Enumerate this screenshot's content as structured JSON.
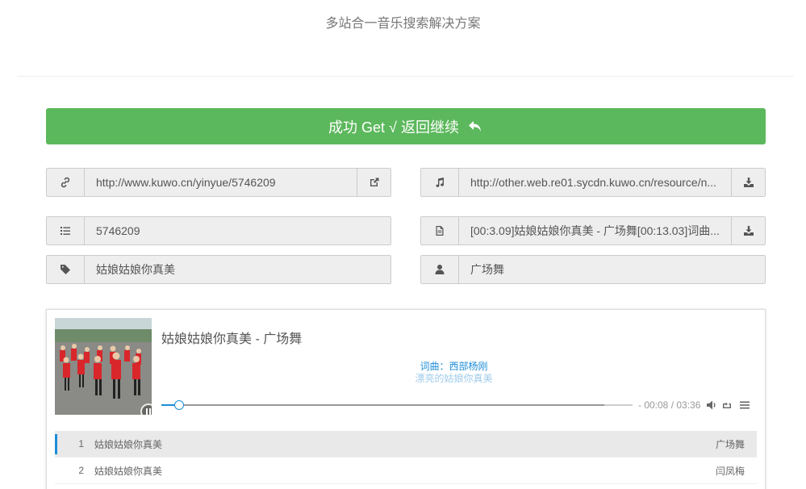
{
  "header": {
    "subtitle": "多站合一音乐搜索解决方案"
  },
  "success_bar": {
    "label": "成功 Get √ 返回继续"
  },
  "fields": {
    "link": {
      "icon": "link-icon",
      "value": "http://www.kuwo.cn/yinyue/5746209"
    },
    "music_url": {
      "icon": "music-icon",
      "value": "http://other.web.re01.sycdn.kuwo.cn/resource/n..."
    },
    "song_id": {
      "icon": "list-icon",
      "value": "5746209"
    },
    "lyrics": {
      "icon": "file-icon",
      "value": "[00:3.09]姑娘姑娘你真美 - 广场舞[00:13.03]词曲..."
    },
    "title": {
      "icon": "tag-icon",
      "value": "姑娘姑娘你真美"
    },
    "artist": {
      "icon": "user-icon",
      "value": "广场舞"
    }
  },
  "player": {
    "title": "姑娘姑娘你真美 - 广场舞",
    "lyric_line_current": "词曲：西部杨刚",
    "lyric_line_next": "漂亮的姑娘你真美",
    "time": "- 00:08 / 03:36",
    "progress_played": 0.038,
    "progress_loaded": 0.94,
    "accent_color": "#1d8dd9",
    "playlist": [
      {
        "num": "1",
        "name": "姑娘姑娘你真美",
        "artist": "广场舞"
      },
      {
        "num": "2",
        "name": "姑娘姑娘你真美",
        "artist": "闫凤梅"
      }
    ]
  },
  "colors": {
    "success": "#5cb85c",
    "field_bg": "#eeeeee"
  }
}
